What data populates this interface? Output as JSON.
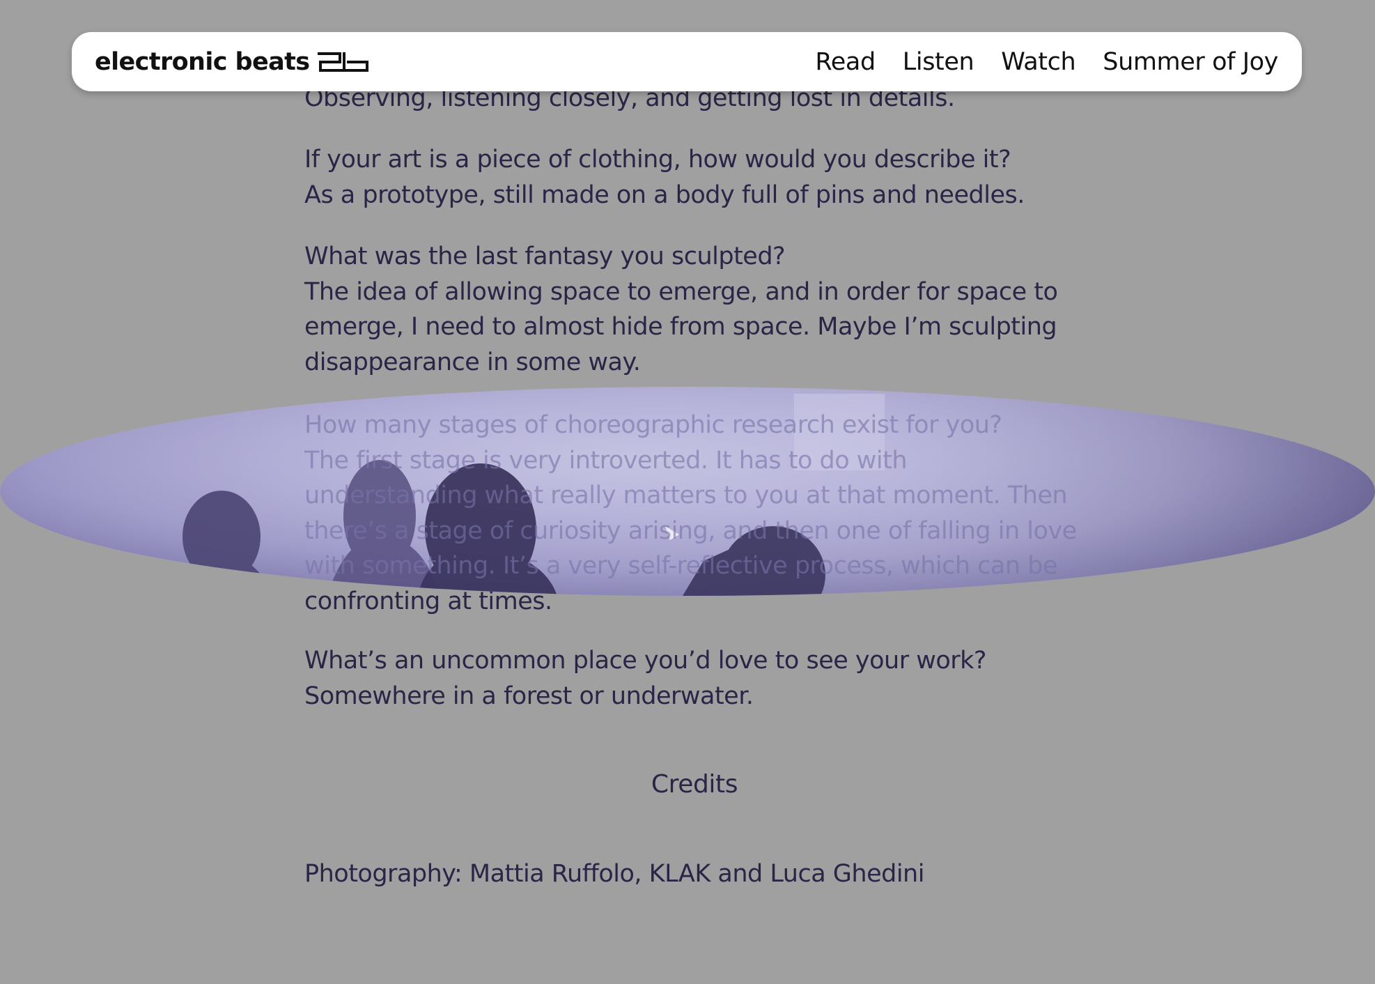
{
  "header": {
    "brand_name": "electronic beats",
    "nav": [
      "Read",
      "Listen",
      "Watch",
      "Summer of Joy"
    ]
  },
  "article": {
    "qa": [
      {
        "lines": [
          "Observing, listening closely, and getting lost in details."
        ]
      },
      {
        "lines": [
          "If your art is a piece of clothing, how would you describe it?",
          "As a prototype, still made on a body full of pins and needles."
        ]
      },
      {
        "lines": [
          "What was the last fantasy you sculpted?",
          "The idea of allowing space to emerge, and in order for space to",
          "emerge, I need to almost hide from space. Maybe I’m sculpting",
          "disappearance in some way."
        ]
      },
      {
        "lines": [
          "How many stages of choreographic research exist for you?",
          "The first stage is very introverted. It has to do with",
          "understanding what really matters to you at that moment. Then",
          "there’s a stage of curiosity arising, and then one of falling in love",
          "with something. It’s a very self-reflective process, which can be",
          "confronting at times."
        ]
      },
      {
        "lines": [
          "What’s an uncommon place you’d love to see your work?",
          "Somewhere in a forest or underwater."
        ]
      }
    ],
    "credits_heading": "Credits",
    "credits_line": "Photography: Mattia Ruffolo, KLAK and Luca Ghedini"
  },
  "colors": {
    "page_background": "#a0a0a0",
    "text": "#2a2547",
    "header_background": "#ffffff",
    "ellipse_tint": "#b3b0d8"
  }
}
